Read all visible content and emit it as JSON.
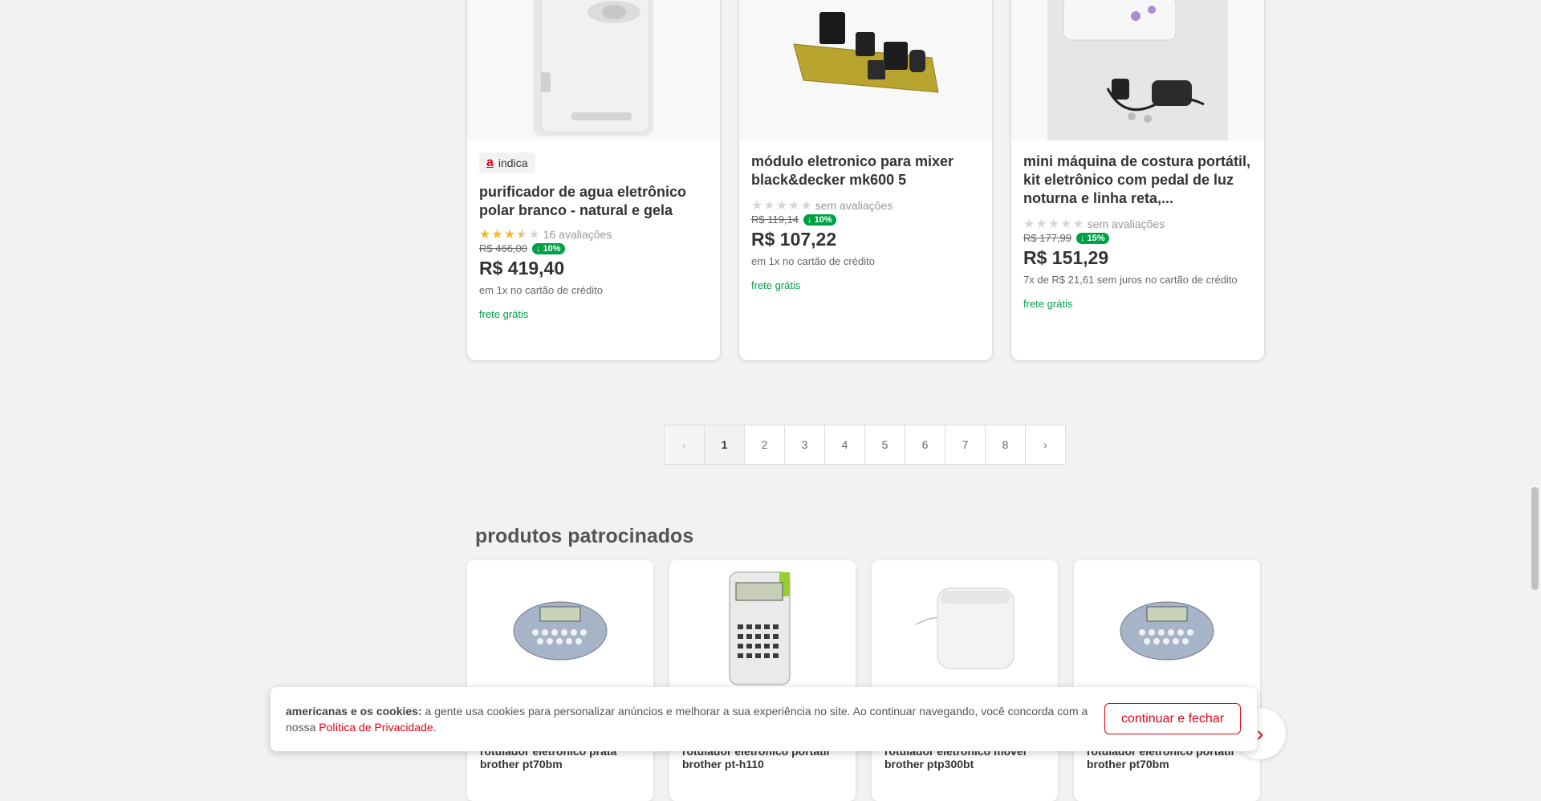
{
  "products": [
    {
      "indica_label": "indica",
      "title": "purificador de agua eletrônico polar branco - natural e gela",
      "rating_count": "16 avaliações",
      "rating": 3.5,
      "old_price": "R$ 466,00",
      "discount": "10%",
      "price": "R$ 419,40",
      "payment": "em 1x no cartão de crédito",
      "shipping": "frete grátis"
    },
    {
      "title": "módulo eletronico para mixer black&decker mk600 5",
      "rating_count": "sem avaliações",
      "rating": 0,
      "old_price": "R$ 119,14",
      "discount": "10%",
      "price": "R$ 107,22",
      "payment": "em 1x no cartão de crédito",
      "shipping": "frete grátis"
    },
    {
      "title": "mini máquina de costura portátil, kit eletrônico com pedal de luz noturna e linha reta,...",
      "rating_count": "sem avaliações",
      "rating": 0,
      "old_price": "R$ 177,99",
      "discount": "15%",
      "price": "R$ 151,29",
      "payment": "7x de R$ 21,61 sem juros no cartão de crédito",
      "shipping": "frete grátis"
    }
  ],
  "pagination": {
    "prev": "‹",
    "next": "›",
    "pages": [
      "1",
      "2",
      "3",
      "4",
      "5",
      "6",
      "7",
      "8"
    ],
    "current": "1"
  },
  "sponsored": {
    "title": "produtos patrocinados",
    "items": [
      {
        "name": "rotulador eletronico prata brother pt70bm"
      },
      {
        "name": "rotulador eletronico portatil brother pt-h110"
      },
      {
        "name": "rotulador eletronico movel brother ptp300bt"
      },
      {
        "name": "rotulador eletronico portatil brother pt70bm"
      }
    ]
  },
  "cookie_banner": {
    "bold": "americanas e os cookies:",
    "text": " a gente usa cookies para personalizar anúncios e melhorar a sua experiência no site. Ao continuar navegando, você concorda com a nossa ",
    "link": "Política de Privacidade",
    "end": ".",
    "button": "continuar e fechar"
  },
  "colors": {
    "brand_red": "#e60014",
    "discount_green": "#00a046",
    "star_gold": "#f9b827"
  }
}
